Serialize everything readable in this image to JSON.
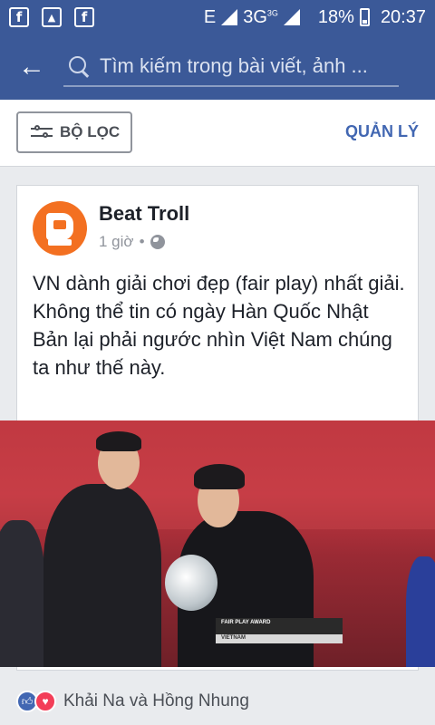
{
  "status_bar": {
    "network": "E",
    "network2": "3G",
    "network2_small": "3G",
    "battery": "18%",
    "time": "20:37"
  },
  "search": {
    "placeholder": "Tìm kiếm trong bài viết, ảnh ..."
  },
  "filter": {
    "filter_label": "BỘ LỌC",
    "manage_label": "QUẢN LÝ"
  },
  "post": {
    "author": "Beat Troll",
    "time": "1 giờ",
    "separator": "•",
    "text_line1": "VN dành giải chơi đẹp (fair play) nhất giải.",
    "text_line2": "Không thể tin có ngày Hàn Quốc Nhật Bản lại phải ngước nhìn Việt Nam chúng ta như thế này.",
    "photo_caption_top": "FAIR PLAY AWARD",
    "photo_caption_bottom": "VIETNAM"
  },
  "reactions": {
    "names": "Khải Na và Hồng Nhung"
  },
  "colors": {
    "brand": "#3b5998",
    "link": "#4267b2",
    "like": "#4267b2",
    "love": "#f33e58"
  }
}
